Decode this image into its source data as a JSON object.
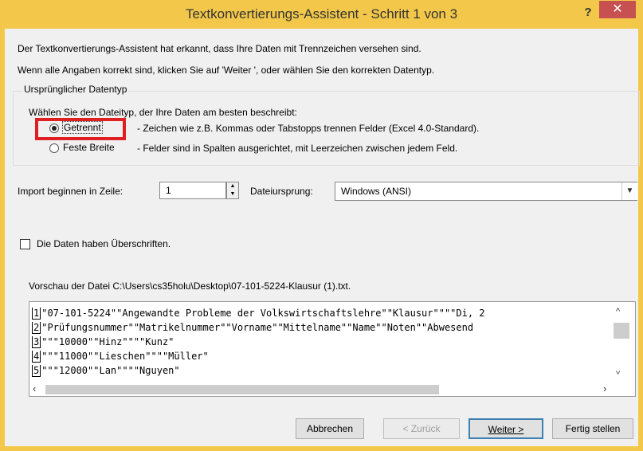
{
  "window": {
    "title": "Textkonvertierungs-Assistent - Schritt 1 von 3",
    "help_glyph": "?",
    "close_glyph": "✕"
  },
  "intro": {
    "line1": "Der Textkonvertierungs-Assistent hat erkannt, dass Ihre Daten mit Trennzeichen versehen sind.",
    "line2": "Wenn alle Angaben korrekt sind, klicken Sie auf 'Weiter ', oder wählen Sie den korrekten Datentyp."
  },
  "datatype_group": {
    "legend": "Ursprünglicher Datentyp",
    "prompt": "Wählen Sie den Dateityp, der Ihre Daten am besten beschreibt:",
    "options": [
      {
        "label": "Getrennt",
        "description": "- Zeichen wie z.B. Kommas oder Tabstopps trennen Felder (Excel 4.0-Standard).",
        "selected": true
      },
      {
        "label": "Feste Breite",
        "description": "- Felder sind in Spalten ausgerichtet, mit Leerzeichen zwischen jedem Feld.",
        "selected": false
      }
    ]
  },
  "import_row": {
    "label": "Import beginnen in Zeile:",
    "value": "1",
    "origin_label": "Dateiursprung:",
    "origin_value": "Windows (ANSI)"
  },
  "headers_checkbox": {
    "label": "Die Daten haben Überschriften.",
    "checked": false
  },
  "preview": {
    "label": "Vorschau der Datei C:\\Users\\cs35holu\\Desktop\\07-101-5224-Klausur (1).txt.",
    "lines": [
      {
        "num": "1",
        "text": "\"07-101-5224\"\"Angewandte Probleme der Volkswirtschaftslehre\"\"Klausur\"\"\"\"Di, 2"
      },
      {
        "num": "2",
        "text": "\"Prüfungsnummer\"\"Matrikelnummer\"\"Vorname\"\"Mittelname\"\"Name\"\"Noten\"\"Abwesend"
      },
      {
        "num": "3",
        "text": "\"\"\"10000\"\"Hinz\"\"\"\"Kunz\""
      },
      {
        "num": "4",
        "text": "\"\"\"11000\"\"Lieschen\"\"\"\"Müller\""
      },
      {
        "num": "5",
        "text": "\"\"\"12000\"\"Lan\"\"\"\"Nguyen\""
      }
    ]
  },
  "buttons": {
    "cancel": "Abbrechen",
    "back": "< Zurück",
    "next": "Weiter >",
    "finish": "Fertig stellen"
  },
  "colors": {
    "frame": "#f3c84a",
    "close": "#c75050",
    "highlight": "#e02020",
    "default_button_border": "#3c7fb1"
  }
}
